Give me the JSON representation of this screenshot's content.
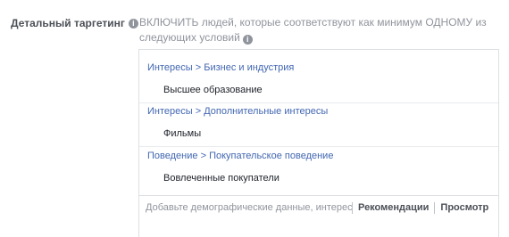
{
  "field": {
    "label": "Детальный таргетинг",
    "description": "ВКЛЮЧИТЬ людей, которые соответствуют как минимум ОДНОМУ из следующих условий"
  },
  "groups": [
    {
      "category": "Интересы",
      "subcategory": "Бизнес и индустрия",
      "item": "Высшее образование"
    },
    {
      "category": "Интересы",
      "subcategory": "Дополнительные интересы",
      "item": "Фильмы"
    },
    {
      "category": "Поведение",
      "subcategory": "Покупательское поведение",
      "item": "Вовлеченные покупатели"
    }
  ],
  "breadcrumb_separator": ">",
  "search": {
    "placeholder": "Добавьте демографические данные, интересы или поведение",
    "value": ""
  },
  "actions": {
    "recommendations_label": "Рекомендации",
    "browse_label": "Просмотр"
  },
  "icons": {
    "info": "info-icon",
    "info_glyph": "i"
  },
  "colors": {
    "link_blue": "#4267b2",
    "label_gray": "#4b4f56",
    "muted_gray": "#90949c",
    "border": "#dddfe2"
  }
}
